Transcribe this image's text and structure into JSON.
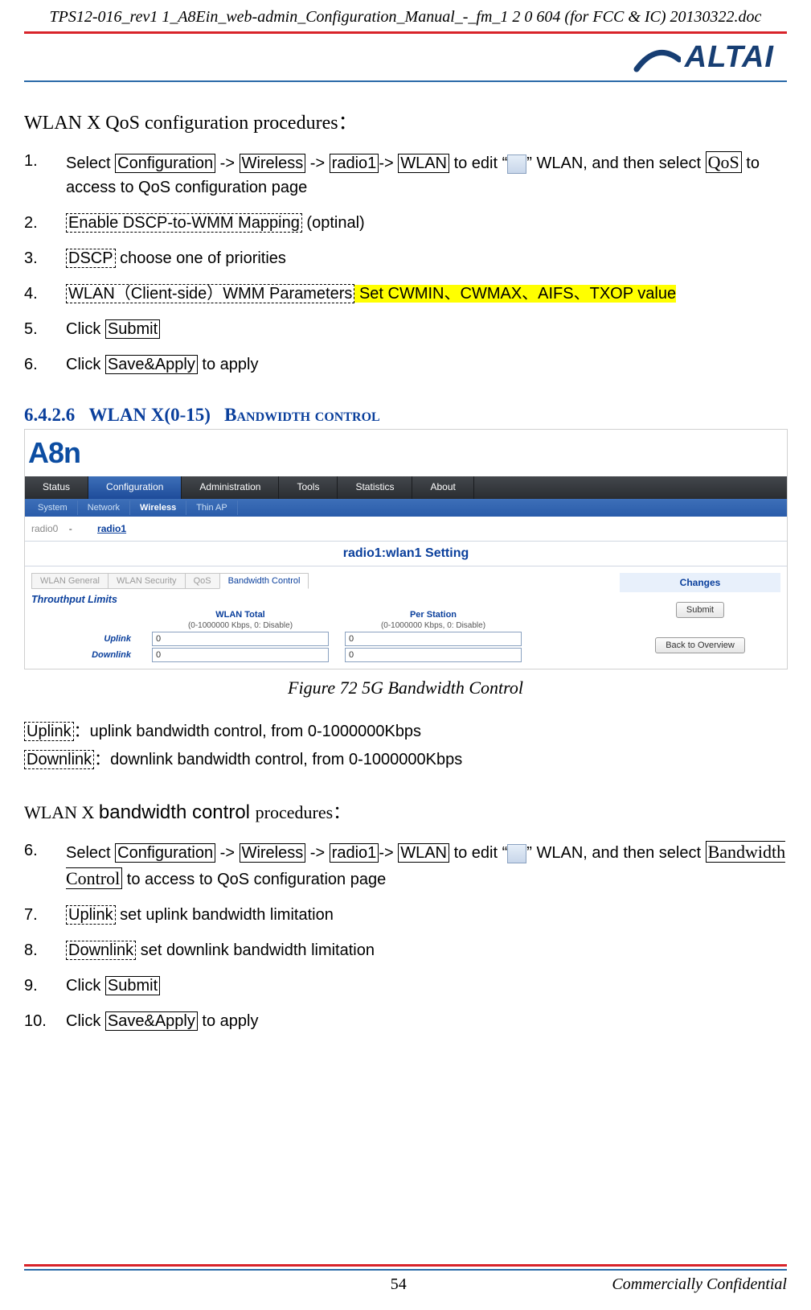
{
  "header": {
    "filename": "TPS12-016_rev1 1_A8Ein_web-admin_Configuration_Manual_-_fm_1 2 0 604 (for FCC & IC) 20130322.doc",
    "logo_text": "ALTAI"
  },
  "section1": {
    "title": "WLAN X QoS configuration procedures：",
    "steps": {
      "s1": {
        "num": "1.",
        "t1": "Select ",
        "configuration": "Configuration",
        "t2": " -> ",
        "wireless": "Wireless",
        "t3": " -> ",
        "radio1": "radio1",
        "t4": "-> ",
        "wlan": "WLAN",
        "t5": " to edit   “",
        "t6": "”   WLAN, and then select ",
        "qos": "QoS",
        "t7": " to access to QoS configuration page"
      },
      "s2": {
        "num": "2.",
        "label": "Enable DSCP-to-WMM Mapping",
        "tail": " (optinal)"
      },
      "s3": {
        "num": "3.",
        "label": "DSCP",
        "tail": " choose one of priorities"
      },
      "s4": {
        "num": "4.",
        "label": "WLAN（Client-side）WMM Parameters",
        "highlight": " Set CWMIN、CWMAX、AIFS、TXOP value"
      },
      "s5": {
        "num": "5.",
        "t1": "Click ",
        "btn": "Submit"
      },
      "s6": {
        "num": "6.",
        "t1": "Click ",
        "btn": "Save&Apply",
        "tail": " to apply"
      }
    }
  },
  "subheading": {
    "num": "6.4.2.6",
    "title1": "WLAN X(0-15)",
    "title2": "Bandwidth control"
  },
  "screenshot": {
    "logo": "A8n",
    "main_tabs": [
      "Status",
      "Configuration",
      "Administration",
      "Tools",
      "Statistics",
      "About"
    ],
    "active_main": 1,
    "sec_tabs": [
      "System",
      "Network",
      "Wireless",
      "Thin AP"
    ],
    "active_sec": 2,
    "radio0": "radio0",
    "radio1": "radio1",
    "radio_sep": "-",
    "setting_title": "radio1:wlan1 Setting",
    "sub_tabs": [
      "WLAN General",
      "WLAN Security",
      "QoS",
      "Bandwidth Control"
    ],
    "active_sub": 3,
    "tp_label": "Throuthput Limits",
    "col1": "WLAN Total",
    "col2": "Per Station",
    "hint": "(0-1000000 Kbps, 0: Disable)",
    "row1": "Uplink",
    "row2": "Downlink",
    "val": "0",
    "changes": "Changes",
    "submit_btn": "Submit",
    "back_btn": "Back to Overview"
  },
  "figure_caption": "Figure 72 5G Bandwidth Control",
  "definitions": {
    "uplink_label": "Uplink",
    "uplink_text": "：uplink bandwidth control, from 0-1000000Kbps",
    "downlink_label": "Downlink",
    "downlink_text": "：downlink bandwidth control, from 0-1000000Kbps"
  },
  "section2": {
    "title_pre": "WLAN X ",
    "title_mid": "bandwidth control ",
    "title_post": "procedures：",
    "steps": {
      "s6": {
        "num": "6.",
        "t1": "Select ",
        "configuration": "Configuration",
        "t2": " -> ",
        "wireless": "Wireless",
        "t3": " -> ",
        "radio1": "radio1",
        "t4": "-> ",
        "wlan": "WLAN",
        "t5": " to edit  “",
        "t6": "”  WLAN, and then select ",
        "bc": "Bandwidth Control",
        "t7": " to access to QoS configuration page"
      },
      "s7": {
        "num": "7.",
        "label": "Uplink",
        "tail": " set uplink bandwidth limitation"
      },
      "s8": {
        "num": "8.",
        "label": "Downlink",
        "tail": " set downlink bandwidth limitation"
      },
      "s9": {
        "num": "9.",
        "t1": "Click ",
        "btn": "Submit"
      },
      "s10": {
        "num": "10.",
        "t1": "Click ",
        "btn": "Save&Apply",
        "tail": " to apply"
      }
    }
  },
  "footer": {
    "page": "54",
    "confidential": "Commercially Confidential"
  }
}
